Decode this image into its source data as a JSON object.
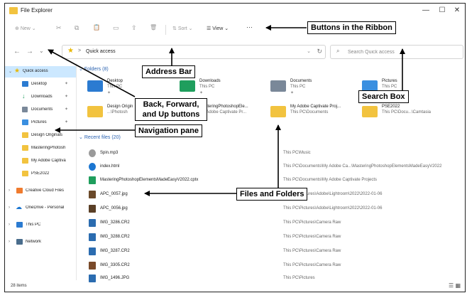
{
  "window": {
    "title": "File Explorer",
    "minimize_glyph": "—",
    "maximize_glyph": "☐",
    "close_glyph": "✕"
  },
  "ribbon": {
    "new_label": "New",
    "new_chevron": "⌄",
    "cut_glyph": "✂",
    "copy_glyph": "⧉",
    "paste_glyph": "📋",
    "rename_glyph": "▭",
    "share_glyph": "⇪",
    "delete_glyph": "🗑",
    "sort_label": "Sort",
    "view_label": "View",
    "more_label": "···"
  },
  "address": {
    "back_glyph": "←",
    "forward_glyph": "→",
    "recent_glyph": "⌄",
    "up_glyph": "↑",
    "star_glyph": "★",
    "separator": ">",
    "path": "Quick access",
    "dropdown_glyph": "⌄",
    "refresh_glyph": "↻"
  },
  "search": {
    "icon_glyph": "⌕",
    "placeholder": "Search Quick access"
  },
  "nav": {
    "items": [
      {
        "label": "Quick access",
        "chev": "⌄",
        "pin": ""
      },
      {
        "label": "Desktop",
        "chev": "",
        "pin": "✦"
      },
      {
        "label": "Downloads",
        "chev": "",
        "pin": "✦"
      },
      {
        "label": "Documents",
        "chev": "",
        "pin": "✦"
      },
      {
        "label": "Pictures",
        "chev": "",
        "pin": "✦"
      },
      {
        "label": "Design Originals",
        "chev": "",
        "pin": ""
      },
      {
        "label": "MasteringPhotosh",
        "chev": "",
        "pin": ""
      },
      {
        "label": "My Adobe Captiva",
        "chev": "",
        "pin": ""
      },
      {
        "label": "PSE2022",
        "chev": "",
        "pin": ""
      },
      {
        "label": "Creative Cloud Files",
        "chev": "›",
        "pin": ""
      },
      {
        "label": "OneDrive - Personal",
        "chev": "›",
        "pin": ""
      },
      {
        "label": "This PC",
        "chev": "›",
        "pin": ""
      },
      {
        "label": "Network",
        "chev": "›",
        "pin": ""
      }
    ]
  },
  "folders": {
    "header": "Folders (8)",
    "chev": "⌄",
    "tiles": [
      {
        "name": "Desktop",
        "sub": "This PC",
        "pin": "✦"
      },
      {
        "name": "Downloads",
        "sub": "This PC",
        "pin": "✦"
      },
      {
        "name": "Documents",
        "sub": "This PC",
        "pin": "✦"
      },
      {
        "name": "Pictures",
        "sub": "This PC",
        "pin": "✦"
      },
      {
        "name": "Design Origin",
        "sub": "...\\Photosh",
        "pin": ""
      },
      {
        "name": "MasteringPhotoshopEle...",
        "sub": "My Adobe Captivate Pr...",
        "pin": ""
      },
      {
        "name": "My Adobe Captivate Proj...",
        "sub": "This PC\\Documents",
        "pin": ""
      },
      {
        "name": "PSE2022",
        "sub": "This PC\\Docu...\\Camtasia",
        "pin": ""
      }
    ]
  },
  "recent": {
    "header": "Recent files (20)",
    "chev": "⌄",
    "files": [
      {
        "name": "Spin.mp3",
        "location": "This PC\\Music"
      },
      {
        "name": "index.html",
        "location": "This PC\\Documents\\My Adobe Ca...\\MasteringPhotoshopElementsMadeEasyV2022"
      },
      {
        "name": "MasteringPhotoshopElementsMadeEasyV2022.cptx",
        "location": "This PC\\Documents\\My Adobe Captivate Projects"
      },
      {
        "name": "APC_0057.jpg",
        "location": "This PC\\Pictures\\Adobe\\Lightroom\\2022\\2022-01-06"
      },
      {
        "name": "APC_0056.jpg",
        "location": "This PC\\Pictures\\Adobe\\Lightroom\\2022\\2022-01-06"
      },
      {
        "name": "IMG_3286.CR2",
        "location": "This PC\\Pictures\\Camera Raw"
      },
      {
        "name": "IMG_3288.CR2",
        "location": "This PC\\Pictures\\Camera Raw"
      },
      {
        "name": "IMG_3287.CR2",
        "location": "This PC\\Pictures\\Camera Raw"
      },
      {
        "name": "IMG_3305.CR2",
        "location": "This PC\\Pictures\\Camera Raw"
      },
      {
        "name": "IMG_1496.JPG",
        "location": "This PC\\Pictures"
      }
    ]
  },
  "status": {
    "count": "28 items",
    "details_glyph": "☰",
    "tiles_glyph": "▦"
  },
  "callouts": {
    "ribbon": "Buttons  in the Ribbon",
    "address": "Address  Bar",
    "backfwd": "Back, Forward,\nand Up buttons",
    "navpane": "Navigation pane",
    "search": "Search Box",
    "files": "Files and Folders"
  },
  "colors": {
    "folder": "#f2c33f",
    "selected": "#cce8ff",
    "accent": "#2a62b0",
    "desktop": "#2b7bd1",
    "downloads": "#1f9e5d",
    "documents": "#7a8899",
    "pictures": "#3a8fe0"
  }
}
